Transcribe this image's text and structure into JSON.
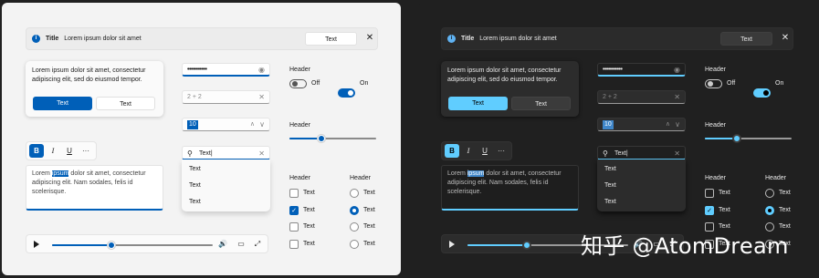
{
  "infobar": {
    "title": "Title",
    "message": "Lorem ipsum dolor sit amet",
    "button": "Text",
    "close_glyph": "✕",
    "icon": "info-icon"
  },
  "dialog": {
    "body": "Lorem ipsum dolor sit amet, consectetur adipiscing elit, sed do eiusmod tempor.",
    "primary": "Text",
    "secondary": "Text"
  },
  "toolbar": {
    "bold": "B",
    "italic": "I",
    "underline": "U",
    "more": "···"
  },
  "rich_text": {
    "before": "Lorem ",
    "selected": "ipsum",
    "after": " dolor sit amet, consectetur adipiscing elit. Nam sodales, felis id scelerisque."
  },
  "password": {
    "value": "•••••••••••",
    "reveal_icon": "eye-icon"
  },
  "math_input": {
    "value": "2 + 2",
    "clear_glyph": "✕"
  },
  "number_box": {
    "value": "10",
    "up_glyph": "∧",
    "down_glyph": "∨"
  },
  "search": {
    "value": "Text|",
    "icon": "search-icon",
    "clear_glyph": "✕"
  },
  "suggestions": [
    "Text",
    "Text",
    "Text"
  ],
  "toggles": {
    "header": "Header",
    "off_label": "Off",
    "on_label": "On"
  },
  "slider": {
    "header": "Header",
    "value_pct": 37
  },
  "checkboxes": {
    "header": "Header",
    "items": [
      {
        "label": "Text",
        "checked": false
      },
      {
        "label": "Text",
        "checked": true
      },
      {
        "label": "Text",
        "checked": false
      },
      {
        "label": "Text",
        "checked": false
      }
    ]
  },
  "radios": {
    "header": "Header",
    "items": [
      {
        "label": "Text",
        "checked": false
      },
      {
        "label": "Text",
        "checked": true
      },
      {
        "label": "Text",
        "checked": false
      },
      {
        "label": "Text",
        "checked": false
      }
    ]
  },
  "media": {
    "progress_pct": 37,
    "volume_glyph": "🔊",
    "cc_glyph": "▭",
    "fullscreen_glyph": "⤢"
  },
  "watermark": "知乎 @AtomDream",
  "colors": {
    "light_accent": "#005fb8",
    "dark_accent": "#60cdff",
    "light_bg": "#f3f3f3",
    "dark_bg": "#202020"
  }
}
